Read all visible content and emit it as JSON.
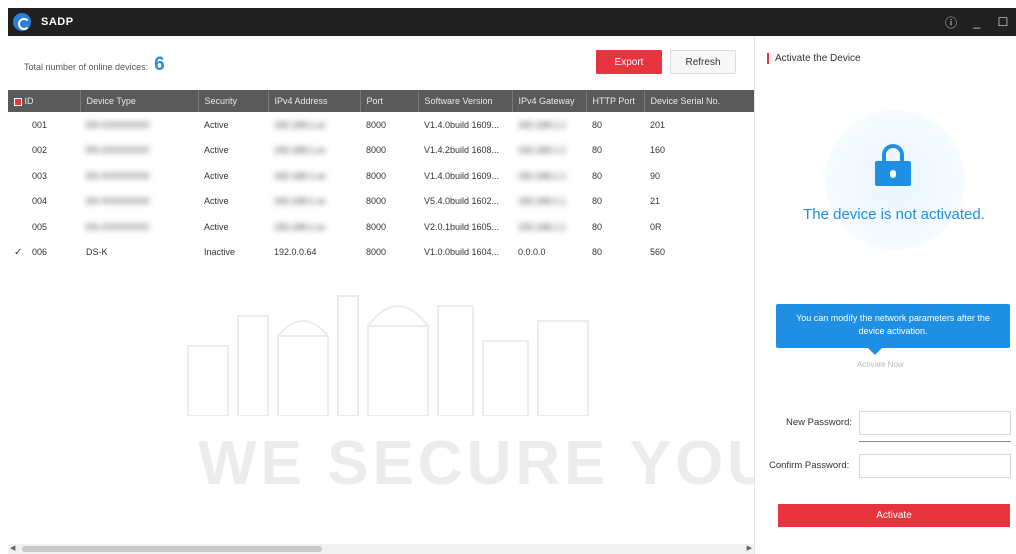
{
  "window": {
    "title": "SADP"
  },
  "summary": {
    "label": "Total number of online devices:",
    "count": "6"
  },
  "toolbar": {
    "export_label": "Export",
    "refresh_label": "Refresh"
  },
  "table": {
    "columns": [
      "ID",
      "Device Type",
      "Security",
      "IPv4 Address",
      "Port",
      "Software Version",
      "IPv4 Gateway",
      "HTTP Port",
      "Device Serial No."
    ],
    "rows": [
      {
        "id": "001",
        "device_type": "DS-XXXXXXXX",
        "security": "Active",
        "ipv4": "192.168.1.xx",
        "port": "8000",
        "software": "V1.4.0build 1609...",
        "gateway": "192.168.1.1",
        "http_port": "80",
        "serial": "201",
        "checked": false,
        "blurred": true
      },
      {
        "id": "002",
        "device_type": "DS-XXXXXXXX",
        "security": "Active",
        "ipv4": "192.168.1.xx",
        "port": "8000",
        "software": "V1.4.2build 1608...",
        "gateway": "192.168.1.1",
        "http_port": "80",
        "serial": "160",
        "checked": false,
        "blurred": true
      },
      {
        "id": "003",
        "device_type": "DS-XXXXXXXX",
        "security": "Active",
        "ipv4": "192.168.1.xx",
        "port": "8000",
        "software": "V1.4.0build 1609...",
        "gateway": "192.168.1.1",
        "http_port": "80",
        "serial": "90",
        "checked": false,
        "blurred": true
      },
      {
        "id": "004",
        "device_type": "DS-XXXXXXXX",
        "security": "Active",
        "ipv4": "192.168.1.xx",
        "port": "8000",
        "software": "V5.4.0build 1602...",
        "gateway": "192.168.1.1",
        "http_port": "80",
        "serial": "21",
        "checked": false,
        "blurred": true
      },
      {
        "id": "005",
        "device_type": "DS-XXXXXXXX",
        "security": "Active",
        "ipv4": "192.168.1.xx",
        "port": "8000",
        "software": "V2.0.1build 1605...",
        "gateway": "192.168.1.1",
        "http_port": "80",
        "serial": "0R",
        "checked": false,
        "blurred": true
      },
      {
        "id": "006",
        "device_type": "DS-K",
        "security": "Inactive",
        "ipv4": "192.0.0.64",
        "port": "8000",
        "software": "V1.0.0build 1604...",
        "gateway": "0.0.0.0",
        "http_port": "80",
        "serial": "560",
        "checked": true,
        "blurred": false
      }
    ]
  },
  "watermark": {
    "text": "WE SECURE YOUR LIFE"
  },
  "activate_panel": {
    "title": "Activate the Device",
    "status": "The device is not activated.",
    "tooltip": "You can modify the network parameters after the device activation.",
    "faint_link": "Activate Now",
    "new_password_label": "New Password:",
    "confirm_password_label": "Confirm Password:",
    "activate_label": "Activate"
  },
  "colors": {
    "accent_red": "#e8343f",
    "accent_blue": "#1e8fe3",
    "header_gray": "#5a5a5a",
    "titlebar": "#202020"
  }
}
